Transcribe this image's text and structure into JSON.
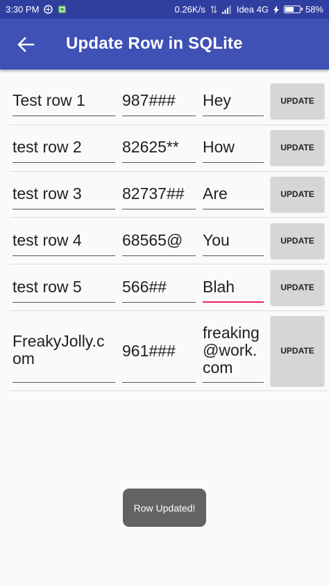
{
  "status_bar": {
    "time": "3:30 PM",
    "speed": "0.26K/s",
    "carrier": "Idea 4G",
    "battery": "58%",
    "battery_level": 0.58
  },
  "app_bar": {
    "title": "Update Row in SQLite",
    "back_icon": "arrow-back-icon"
  },
  "rows": [
    {
      "name": "Test row 1",
      "code": "987###",
      "note": "Hey",
      "button": "UPDATE"
    },
    {
      "name": "test row 2",
      "code": "82625**",
      "note": "How",
      "button": "UPDATE"
    },
    {
      "name": "test row 3",
      "code": "82737##",
      "note": "Are",
      "button": "UPDATE"
    },
    {
      "name": "test row 4",
      "code": "68565@",
      "note": "You",
      "button": "UPDATE"
    },
    {
      "name": "test row 5",
      "code": "566##",
      "note": "Blah",
      "button": "UPDATE"
    },
    {
      "name": "FreakyJolly.c\nom",
      "code": "961###",
      "note": "freaking\n@work.\ncom",
      "button": "UPDATE"
    }
  ],
  "toast": {
    "text": "Row Updated!"
  },
  "colors": {
    "primary": "#3f51b5",
    "primary_dark": "#303f9f",
    "accent": "#e91e63"
  }
}
